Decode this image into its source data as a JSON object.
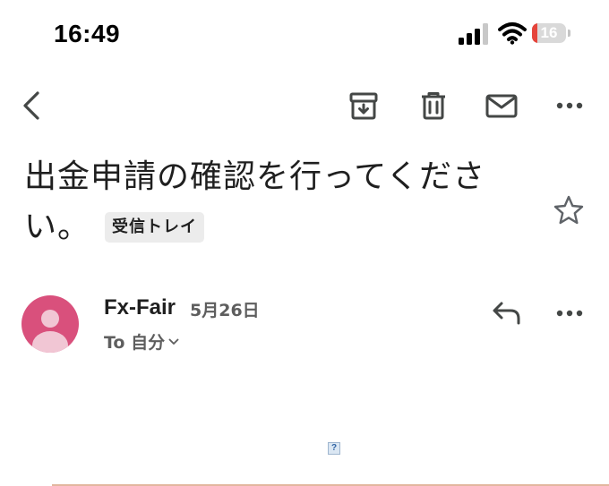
{
  "status_bar": {
    "time": "16:49",
    "battery_level": "16",
    "battery_fraction": 0.16,
    "signal_bars_active": 3,
    "signal_bars_total": 4,
    "colors": {
      "battery_low": "#e5443b"
    }
  },
  "toolbar": {
    "icons": [
      "chevron-left-icon",
      "archive-icon",
      "trash-icon",
      "mail-icon",
      "more-horizontal-icon"
    ]
  },
  "email": {
    "subject": "出金申請の確認を行ってください。",
    "label": "受信トレイ",
    "sender": {
      "name": "Fx-Fair",
      "date": "5月26日",
      "recipient_prefix": "To",
      "recipient": "自分",
      "avatar_color": "#d9507c"
    },
    "body_image_placeholder": "?"
  }
}
